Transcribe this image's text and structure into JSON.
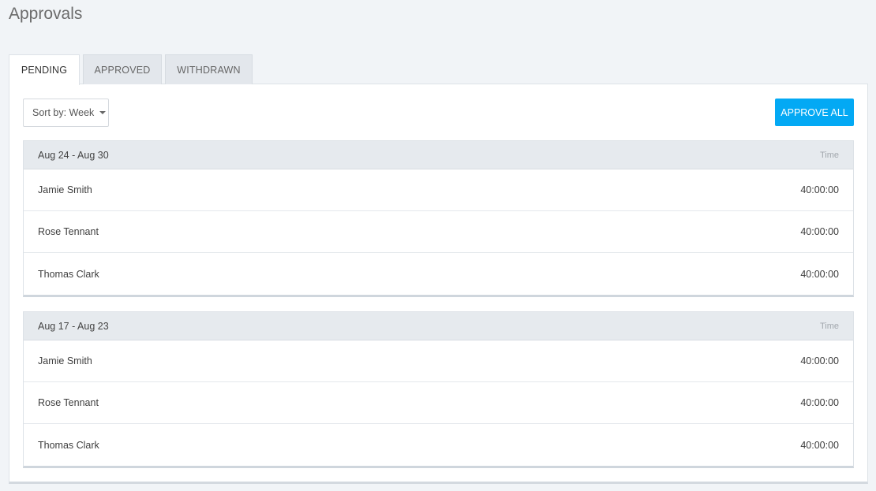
{
  "page": {
    "title": "Approvals"
  },
  "tabs": [
    {
      "label": "PENDING",
      "active": true
    },
    {
      "label": "APPROVED",
      "active": false
    },
    {
      "label": "WITHDRAWN",
      "active": false
    }
  ],
  "toolbar": {
    "sort_label": "Sort by: Week",
    "approve_all_label": "APPROVE ALL"
  },
  "groups": [
    {
      "range": "Aug 24 - Aug 30",
      "column": "Time",
      "rows": [
        {
          "name": "Jamie Smith",
          "time": "40:00:00"
        },
        {
          "name": "Rose Tennant",
          "time": "40:00:00"
        },
        {
          "name": "Thomas Clark",
          "time": "40:00:00"
        }
      ]
    },
    {
      "range": "Aug 17 - Aug 23",
      "column": "Time",
      "rows": [
        {
          "name": "Jamie Smith",
          "time": "40:00:00"
        },
        {
          "name": "Rose Tennant",
          "time": "40:00:00"
        },
        {
          "name": "Thomas Clark",
          "time": "40:00:00"
        }
      ]
    }
  ],
  "colors": {
    "accent": "#03a9f4",
    "background": "#f1f4f7",
    "header": "#e6eaee"
  }
}
